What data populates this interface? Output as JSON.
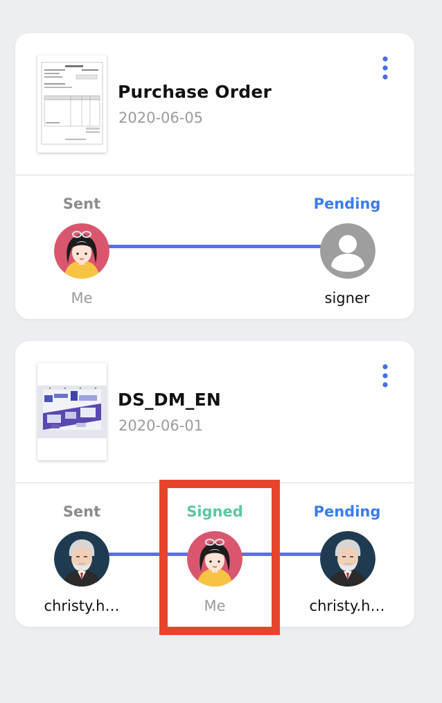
{
  "documents": [
    {
      "title": "Purchase Order",
      "date": "2020-06-05",
      "thumbnail": "purchase-order-thumbnail",
      "line_color": "#5b6fe6",
      "participants": [
        {
          "status": "Sent",
          "status_color": "#8c8c8c",
          "name": "Me",
          "avatar": "woman-avatar"
        },
        {
          "status": "Pending",
          "status_color": "#3b7cf0",
          "name": "signer",
          "avatar": "generic-user-icon"
        }
      ]
    },
    {
      "title": "DS_DM_EN",
      "date": "2020-06-01",
      "thumbnail": "brochure-thumbnail",
      "line_color": "#5b6fe6",
      "participants": [
        {
          "status": "Sent",
          "status_color": "#8c8c8c",
          "name": "christy.h…",
          "avatar": "old-man-avatar"
        },
        {
          "status": "Signed",
          "status_color": "#5cc7a1",
          "name": "Me",
          "avatar": "woman-avatar"
        },
        {
          "status": "Pending",
          "status_color": "#3b7cf0",
          "name": "christy.h…",
          "avatar": "old-man-avatar"
        }
      ]
    }
  ],
  "highlight_color": "#e8442c",
  "icons": [
    "more-vertical-icon"
  ]
}
